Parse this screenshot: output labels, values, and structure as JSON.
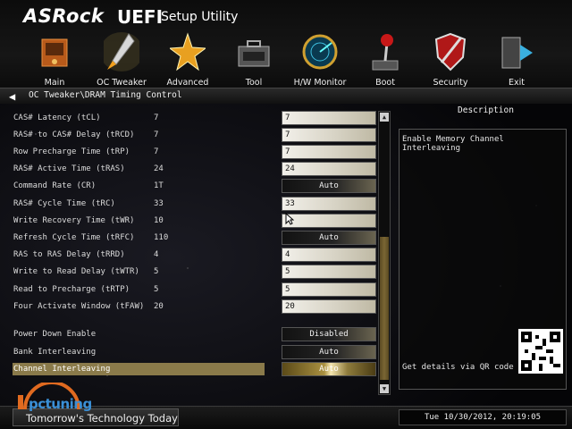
{
  "header": {
    "brand": "ASRock",
    "uefi": "UEFI",
    "setup": "Setup Utility"
  },
  "nav": [
    {
      "label": "Main",
      "icon": "main-icon"
    },
    {
      "label": "OC Tweaker",
      "icon": "rocket-icon"
    },
    {
      "label": "Advanced",
      "icon": "star-icon"
    },
    {
      "label": "Tool",
      "icon": "toolbox-icon"
    },
    {
      "label": "H/W Monitor",
      "icon": "radar-icon"
    },
    {
      "label": "Boot",
      "icon": "joystick-icon"
    },
    {
      "label": "Security",
      "icon": "shield-icon"
    },
    {
      "label": "Exit",
      "icon": "exit-icon"
    }
  ],
  "breadcrumb": "OC Tweaker\\DRAM Timing Control",
  "settings": [
    {
      "name": "CAS# Latency (tCL)",
      "current": "7",
      "value": "7",
      "kind": "field"
    },
    {
      "name": "RAS# to CAS# Delay (tRCD)",
      "current": "7",
      "value": "7",
      "kind": "field"
    },
    {
      "name": "Row Precharge Time (tRP)",
      "current": "7",
      "value": "7",
      "kind": "field"
    },
    {
      "name": "RAS# Active Time (tRAS)",
      "current": "24",
      "value": "24",
      "kind": "field"
    },
    {
      "name": "Command Rate (CR)",
      "current": "1T",
      "value": "Auto",
      "kind": "drop"
    },
    {
      "name": "RAS# Cycle Time (tRC)",
      "current": "33",
      "value": "33",
      "kind": "field"
    },
    {
      "name": "Write Recovery Time (tWR)",
      "current": "10",
      "value": "",
      "kind": "field"
    },
    {
      "name": "Refresh Cycle Time (tRFC)",
      "current": "110",
      "value": "Auto",
      "kind": "drop"
    },
    {
      "name": "RAS to RAS Delay (tRRD)",
      "current": "4",
      "value": "4",
      "kind": "field"
    },
    {
      "name": "Write to Read Delay (tWTR)",
      "current": "5",
      "value": "5",
      "kind": "field"
    },
    {
      "name": "Read to Precharge (tRTP)",
      "current": "5",
      "value": "5",
      "kind": "field"
    },
    {
      "name": "Four Activate Window (tFAW)",
      "current": "20",
      "value": "20",
      "kind": "field"
    },
    {
      "name": "Power Down Enable",
      "current": "",
      "value": "Disabled",
      "kind": "drop"
    },
    {
      "name": "Bank Interleaving",
      "current": "",
      "value": "Auto",
      "kind": "drop"
    },
    {
      "name": "Channel Interleaving",
      "current": "",
      "value": "Auto",
      "kind": "drop-hl",
      "selected": true
    }
  ],
  "description": {
    "title": "Description",
    "text": "Enable Memory Channel Interleaving",
    "qr_text": "Get details via QR code"
  },
  "footer": {
    "tagline": "Tomorrow's Technology Today",
    "datetime": "Tue 10/30/2012, 20:19:05",
    "watermark": "pctuning"
  }
}
